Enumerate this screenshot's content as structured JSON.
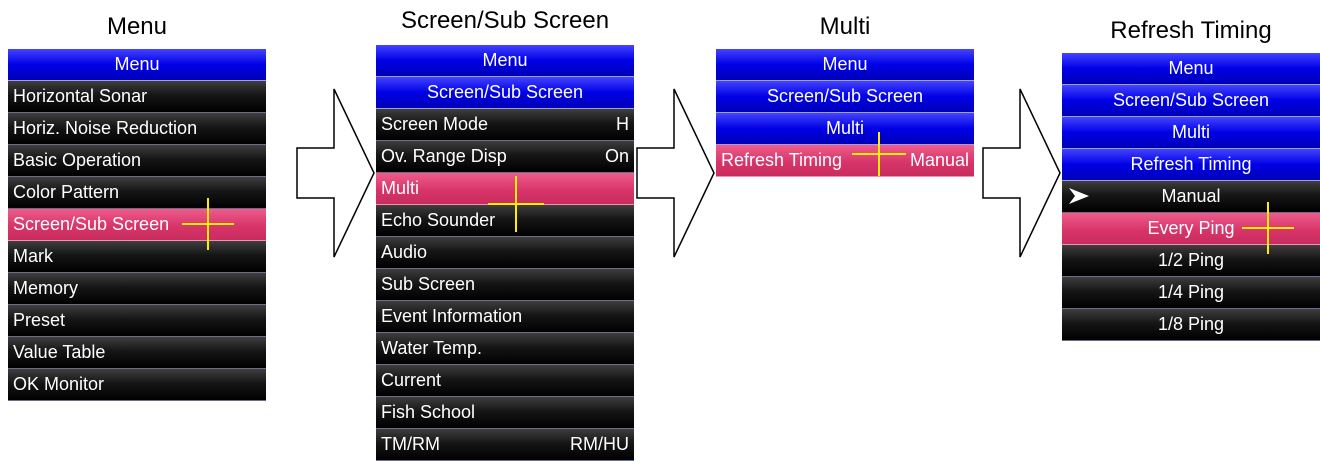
{
  "captions": [
    "Menu",
    "Screen/Sub Screen",
    "Multi",
    "Refresh Timing"
  ],
  "panel1": {
    "header": "Menu",
    "items": [
      {
        "label": "Horizontal Sonar"
      },
      {
        "label": "Horiz. Noise Reduction"
      },
      {
        "label": "Basic Operation"
      },
      {
        "label": "Color Pattern"
      },
      {
        "label": "Screen/Sub Screen",
        "selected": true
      },
      {
        "label": "Mark"
      },
      {
        "label": "Memory"
      },
      {
        "label": "Preset"
      },
      {
        "label": "Value Table"
      },
      {
        "label": "OK Monitor"
      }
    ]
  },
  "panel2": {
    "headers": [
      "Menu",
      "Screen/Sub Screen"
    ],
    "items": [
      {
        "label": "Screen Mode",
        "value": "H"
      },
      {
        "label": "Ov. Range Disp",
        "value": "On"
      },
      {
        "label": "Multi",
        "value": "",
        "selected": true
      },
      {
        "label": "Echo Sounder",
        "value": ""
      },
      {
        "label": "Audio",
        "value": ""
      },
      {
        "label": "Sub Screen",
        "value": ""
      },
      {
        "label": "Event Information",
        "value": ""
      },
      {
        "label": "Water Temp.",
        "value": ""
      },
      {
        "label": "Current",
        "value": ""
      },
      {
        "label": "Fish School",
        "value": ""
      },
      {
        "label": "TM/RM",
        "value": "RM/HU"
      }
    ]
  },
  "panel3": {
    "headers": [
      "Menu",
      "Screen/Sub Screen",
      "Multi"
    ],
    "items": [
      {
        "label": "Refresh Timing",
        "value": "Manual",
        "selected": true
      }
    ]
  },
  "panel4": {
    "headers": [
      "Menu",
      "Screen/Sub Screen",
      "Multi",
      "Refresh Timing"
    ],
    "options": [
      {
        "label": "Manual",
        "current": true
      },
      {
        "label": "Every Ping",
        "selected": true
      },
      {
        "label": "1/2 Ping"
      },
      {
        "label": "1/4 Ping"
      },
      {
        "label": "1/8 Ping"
      }
    ]
  },
  "colors": {
    "header_blue": "#0000e6",
    "selected_pink": "#d8356a",
    "row_black": "#000000",
    "cursor_yellow": "#ffee00"
  },
  "icons": [
    "right-arrow-outline-icon",
    "crosshair-cursor-icon",
    "current-value-arrow-icon"
  ]
}
